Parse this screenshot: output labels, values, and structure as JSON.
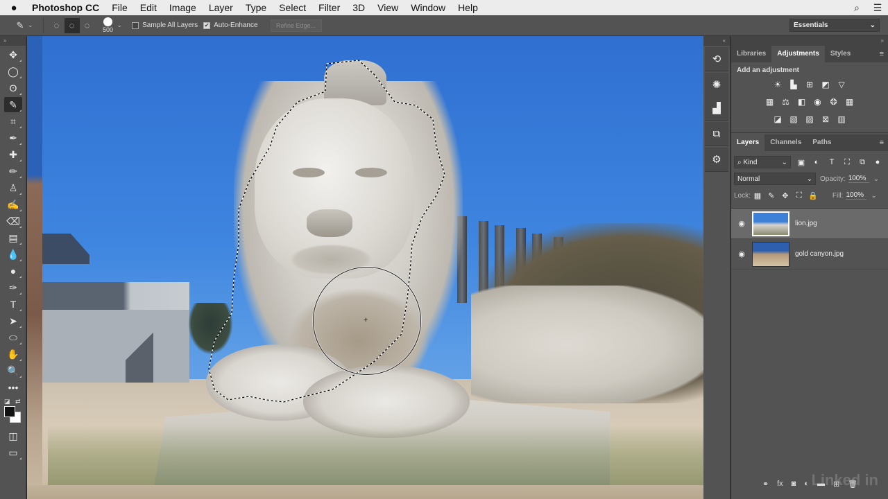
{
  "menubar": {
    "apple_icon": "",
    "app_name": "Photoshop CC",
    "items": [
      "File",
      "Edit",
      "Image",
      "Layer",
      "Type",
      "Select",
      "Filter",
      "3D",
      "View",
      "Window",
      "Help"
    ],
    "search_icon": "⌕",
    "list_icon": "☰"
  },
  "options": {
    "tool_preset_icon": "quick-selection",
    "new_selection_icon": "◌",
    "add_selection_icon": "◌+",
    "subtract_selection_icon": "◌−",
    "brush_size": "500",
    "sample_all_layers": "Sample All Layers",
    "sample_all_layers_checked": false,
    "auto_enhance": "Auto-Enhance",
    "auto_enhance_checked": true,
    "refine_edge": "Refine Edge...",
    "workspace": "Essentials"
  },
  "tools": [
    {
      "name": "move",
      "glyph": "✥"
    },
    {
      "name": "marquee",
      "glyph": "◯"
    },
    {
      "name": "lasso",
      "glyph": "ʘ"
    },
    {
      "name": "quick-selection",
      "glyph": "✎",
      "active": true
    },
    {
      "name": "crop",
      "glyph": "⌗"
    },
    {
      "name": "eyedropper",
      "glyph": "✒"
    },
    {
      "name": "healing",
      "glyph": "✚"
    },
    {
      "name": "brush",
      "glyph": "✏"
    },
    {
      "name": "clone-stamp",
      "glyph": "♙"
    },
    {
      "name": "history-brush",
      "glyph": "✍"
    },
    {
      "name": "eraser",
      "glyph": "⌫"
    },
    {
      "name": "gradient",
      "glyph": "▤"
    },
    {
      "name": "blur",
      "glyph": "💧"
    },
    {
      "name": "dodge",
      "glyph": "●"
    },
    {
      "name": "pen",
      "glyph": "✑"
    },
    {
      "name": "type",
      "glyph": "T"
    },
    {
      "name": "path-selection",
      "glyph": "➤"
    },
    {
      "name": "ellipse",
      "glyph": "⬭"
    },
    {
      "name": "hand",
      "glyph": "✋"
    },
    {
      "name": "zoom",
      "glyph": "🔍"
    },
    {
      "name": "more",
      "glyph": "•••"
    }
  ],
  "bottom_tools": [
    {
      "name": "quick-mask",
      "glyph": "◫"
    },
    {
      "name": "screen-mode",
      "glyph": "▭"
    }
  ],
  "colors": {
    "foreground": "#111111",
    "background": "#ffffff"
  },
  "dock": {
    "collapse_icon": "«",
    "buttons": [
      {
        "name": "history",
        "glyph": "⟲"
      },
      {
        "name": "brush-settings",
        "glyph": "✺"
      },
      {
        "name": "histogram",
        "glyph": "▟"
      },
      {
        "name": "clone-source",
        "glyph": "⧉"
      },
      {
        "name": "properties",
        "glyph": "⚙"
      }
    ]
  },
  "adjust_panel": {
    "collapse_icon": "»",
    "tabs": [
      "Libraries",
      "Adjustments",
      "Styles"
    ],
    "active_tab": "Adjustments",
    "title": "Add an adjustment",
    "rows": [
      [
        "☀",
        "▙",
        "⊞",
        "◩",
        "▽"
      ],
      [
        "▦",
        "⚖",
        "◧",
        "◉",
        "❂",
        "▦"
      ],
      [
        "◪",
        "▧",
        "▨",
        "⊠",
        "▥"
      ]
    ]
  },
  "layers_panel": {
    "tabs": [
      "Layers",
      "Channels",
      "Paths"
    ],
    "active_tab": "Layers",
    "filter": "Kind",
    "filter_icons": [
      "▣",
      "◐",
      "T",
      "⛶",
      "⧉"
    ],
    "blend_mode": "Normal",
    "opacity_label": "Opacity:",
    "opacity": "100%",
    "lock_label": "Lock:",
    "lock_icons": [
      "▦",
      "✎",
      "✥",
      "⛶",
      "🔒"
    ],
    "fill_label": "Fill:",
    "fill": "100%",
    "layers": [
      {
        "name": "lion.jpg",
        "visible": true,
        "selected": true
      },
      {
        "name": "gold canyon.jpg",
        "visible": true,
        "selected": false
      }
    ],
    "footer_icons": [
      "link",
      "fx",
      "mask",
      "adjustment",
      "group",
      "new-layer",
      "trash"
    ],
    "footer_glyphs": [
      "⚭",
      "fx",
      "◙",
      "◐",
      "▬",
      "⊞",
      "🗑"
    ]
  },
  "watermark": "Linked in"
}
